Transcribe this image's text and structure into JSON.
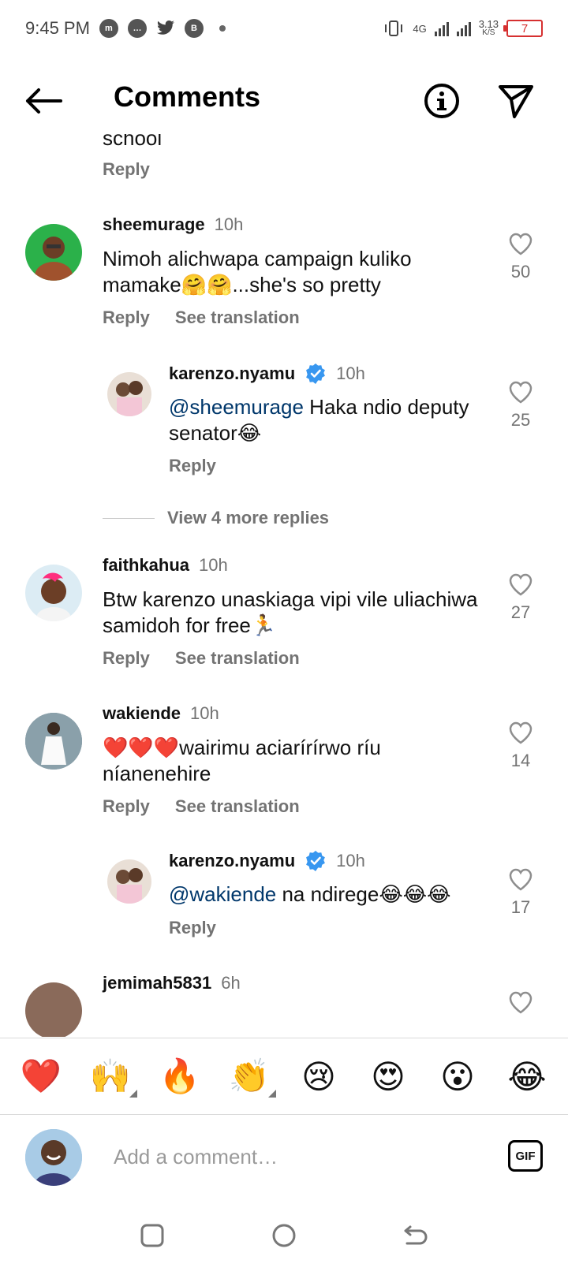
{
  "status_bar": {
    "time": "9:45 PM",
    "network": "4G",
    "speed_value": "3.13",
    "speed_unit": "K/S",
    "battery": "7"
  },
  "header": {
    "title": "Comments"
  },
  "partial": {
    "text": "school",
    "reply": "Reply"
  },
  "comments": [
    {
      "username": "sheemurage",
      "time": "10h",
      "text": "Nimoh alichwapa campaign kuliko mamake🤗🤗...she's so pretty",
      "likes": "50",
      "reply": "Reply",
      "translate": "See translation"
    },
    {
      "username": "karenzo.nyamu",
      "time": "10h",
      "mention": "@sheemurage",
      "text": " Haka ndio deputy senator😂",
      "likes": "25",
      "reply": "Reply"
    },
    {
      "username": "faithkahua",
      "time": "10h",
      "text": "Btw karenzo unaskiaga vipi vile uliachiwa samidoh for free🏃",
      "likes": "27",
      "reply": "Reply",
      "translate": "See translation"
    },
    {
      "username": "wakiende",
      "time": "10h",
      "text": "❤️❤️❤️wairimu aciarírírwo ríu níanenehire",
      "likes": "14",
      "reply": "Reply",
      "translate": "See translation"
    },
    {
      "username": "karenzo.nyamu",
      "time": "10h",
      "mention": "@wakiende",
      "text": " na ndirege😂😂😂",
      "likes": "17",
      "reply": "Reply"
    },
    {
      "username": "jemimah5831",
      "time": "6h"
    }
  ],
  "view_more": "View 4 more replies",
  "emojis": [
    "❤️",
    "🙌",
    "🔥",
    "👏",
    "😢",
    "😍",
    "😮",
    "😂"
  ],
  "composer": {
    "placeholder": "Add a comment…",
    "gif_label": "GIF"
  }
}
